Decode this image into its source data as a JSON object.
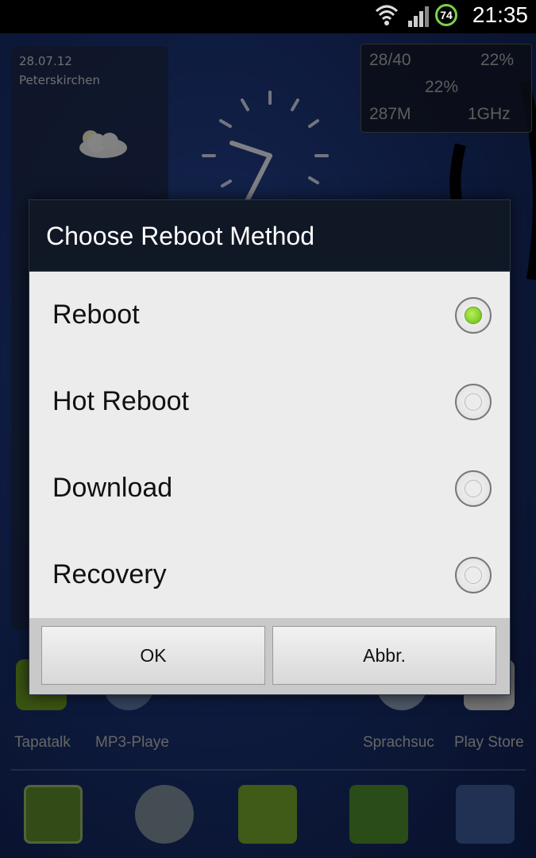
{
  "status_bar": {
    "time": "21:35",
    "battery_level": "74",
    "icons": [
      "wifi-icon",
      "signal-icon",
      "battery-icon"
    ]
  },
  "home": {
    "weather": {
      "date": "28.07.12",
      "location": "Peterskirchen",
      "icon": "cloudy-night-icon"
    },
    "system_monitor": {
      "tasks": "28/40",
      "cpu": "22%",
      "battery": "22%",
      "memory": "287M",
      "frequency": "1GHz"
    },
    "apps": [
      {
        "label": "Tapatalk"
      },
      {
        "label": "MP3-Playe"
      },
      {
        "label": "Sprachsuc"
      },
      {
        "label": "Play Store"
      }
    ],
    "dock": [
      "phone-icon",
      "contacts-icon",
      "messaging-icon",
      "dolphin-browser-icon",
      "facebook-icon"
    ]
  },
  "dialog": {
    "title": "Choose Reboot Method",
    "options": [
      {
        "label": "Reboot",
        "selected": true
      },
      {
        "label": "Hot Reboot",
        "selected": false
      },
      {
        "label": "Download",
        "selected": false
      },
      {
        "label": "Recovery",
        "selected": false
      }
    ],
    "ok_label": "OK",
    "cancel_label": "Abbr."
  },
  "colors": {
    "accent_radio": "#7ccc25",
    "dialog_title_bg": "#111825",
    "dialog_body_bg": "#ececec"
  }
}
